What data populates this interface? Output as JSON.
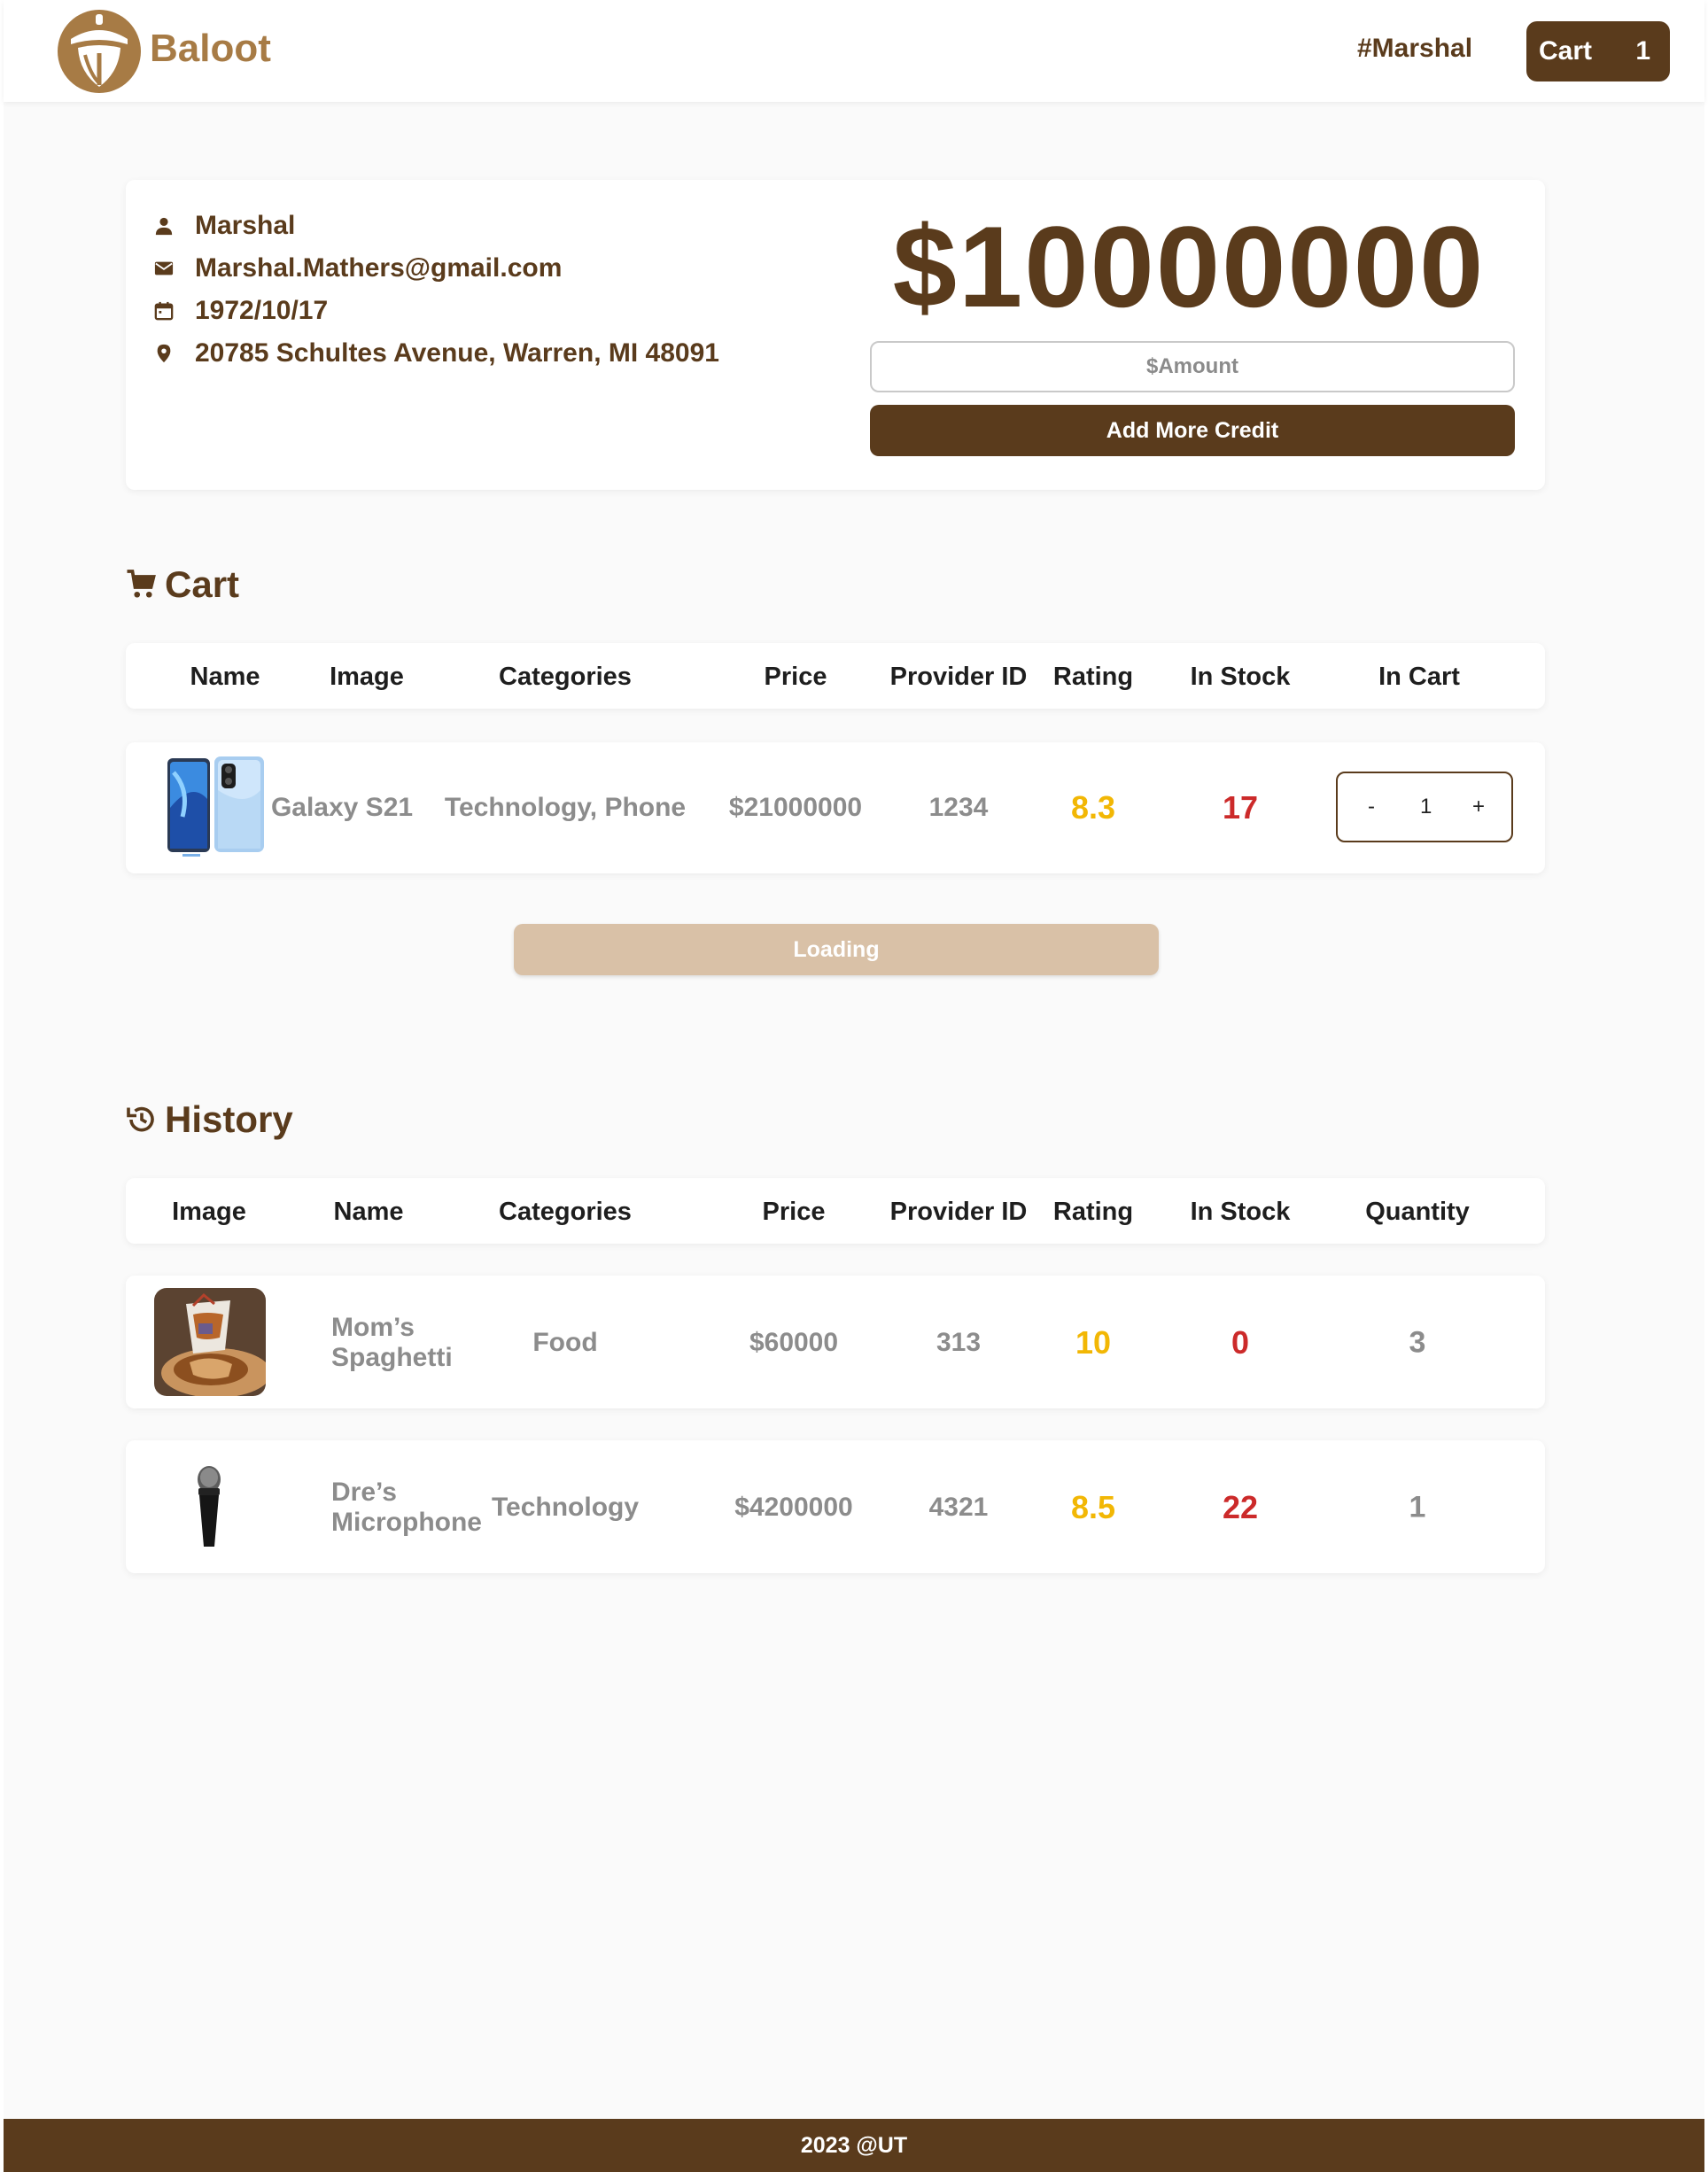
{
  "header": {
    "brand": "Baloot",
    "username": "#Marshal",
    "cart_label": "Cart",
    "cart_count": "1"
  },
  "profile": {
    "name": "Marshal",
    "email": "Marshal.Mathers@gmail.com",
    "birth_date": "1972/10/17",
    "address": "20785 Schultes Avenue, Warren, MI 48091",
    "credit": "$10000000",
    "amount_placeholder": "$Amount",
    "add_credit_label": "Add More Credit"
  },
  "cart": {
    "title": "Cart",
    "columns": [
      "Name",
      "Image",
      "Categories",
      "Price",
      "Provider ID",
      "Rating",
      "In Stock",
      "In Cart"
    ],
    "rows": [
      {
        "name": "Galaxy S21",
        "image": "phone-image",
        "categories": "Technology, Phone",
        "price": "$21000000",
        "provider_id": "1234",
        "rating": "8.3",
        "in_stock": "17",
        "in_cart": "1",
        "minus": "-",
        "plus": "+"
      }
    ],
    "loading_label": "Loading"
  },
  "history": {
    "title": "History",
    "columns": [
      "Image",
      "Name",
      "Categories",
      "Price",
      "Provider ID",
      "Rating",
      "In Stock",
      "Quantity"
    ],
    "rows": [
      {
        "image": "spaghetti-image",
        "name_line1": "Mom’s",
        "name_line2": "Spaghetti",
        "categories": "Food",
        "price": "$60000",
        "provider_id": "313",
        "rating": "10",
        "in_stock": "0",
        "quantity": "3"
      },
      {
        "image": "microphone-image",
        "name_line1": "Dre’s",
        "name_line2": "Microphone",
        "categories": "Technology",
        "price": "$4200000",
        "provider_id": "4321",
        "rating": "8.5",
        "in_stock": "22",
        "quantity": "1"
      }
    ]
  },
  "footer": {
    "text": "2023 @UT"
  },
  "colors": {
    "primary": "#5a3b1c",
    "brand": "#a77b45",
    "rating": "#f2b705",
    "stock": "#cc2a2a",
    "loading": "#d9c1a7"
  }
}
